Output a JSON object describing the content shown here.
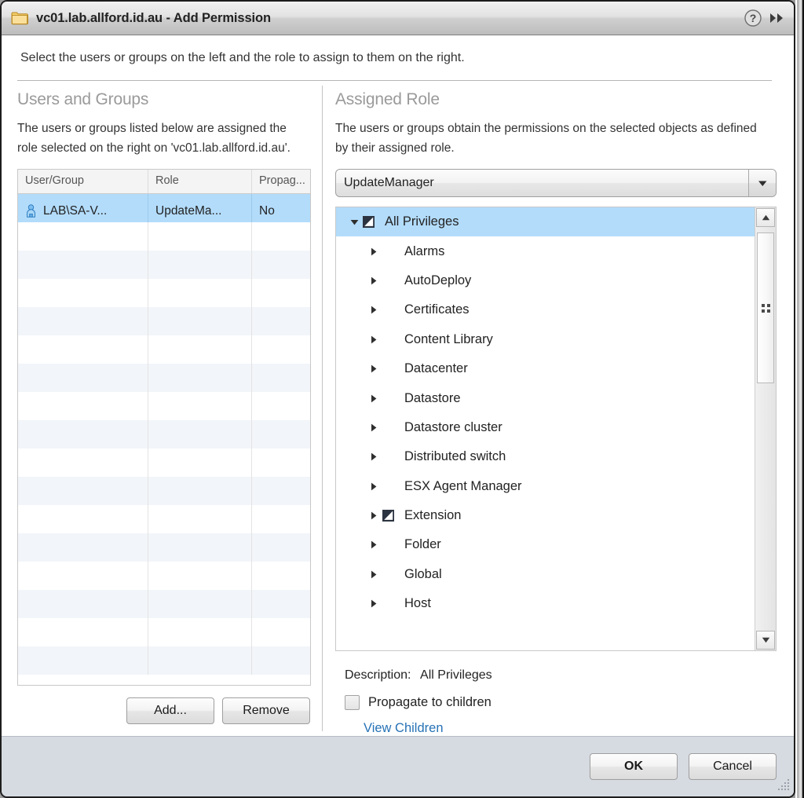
{
  "window": {
    "title": "vc01.lab.allford.id.au - Add Permission",
    "folder_icon": "folder-icon",
    "help_icon": "help-icon",
    "expand_icon": "double-chevron-right-icon"
  },
  "intro": {
    "text": "Select the users or groups on the left and the role to assign to them on the right."
  },
  "left_pane": {
    "heading": "Users and Groups",
    "description": "The users or groups listed below are assigned the role selected on the right on 'vc01.lab.allford.id.au'.",
    "table": {
      "columns": [
        "User/Group",
        "Role",
        "Propag..."
      ],
      "rows": [
        {
          "user": "LAB\\SA-V...",
          "role": "UpdateMa...",
          "propagate": "No",
          "selected": true,
          "icon": "user-icon"
        }
      ],
      "empty_row_count": 16
    },
    "buttons": {
      "add": "Add...",
      "remove": "Remove"
    }
  },
  "right_pane": {
    "heading": "Assigned Role",
    "description": "The users or groups obtain the permissions on the selected objects as defined by their assigned role.",
    "role_select": {
      "value": "UpdateManager",
      "arrow_icon": "chevron-down-icon"
    },
    "tree": [
      {
        "label": "All Privileges",
        "depth": 0,
        "expanded": true,
        "checkbox": "partial",
        "selected": true
      },
      {
        "label": "Alarms",
        "depth": 1,
        "expanded": false,
        "checkbox": "none",
        "selected": false
      },
      {
        "label": "AutoDeploy",
        "depth": 1,
        "expanded": false,
        "checkbox": "none",
        "selected": false
      },
      {
        "label": "Certificates",
        "depth": 1,
        "expanded": false,
        "checkbox": "none",
        "selected": false
      },
      {
        "label": "Content Library",
        "depth": 1,
        "expanded": false,
        "checkbox": "none",
        "selected": false
      },
      {
        "label": "Datacenter",
        "depth": 1,
        "expanded": false,
        "checkbox": "none",
        "selected": false
      },
      {
        "label": "Datastore",
        "depth": 1,
        "expanded": false,
        "checkbox": "none",
        "selected": false
      },
      {
        "label": "Datastore cluster",
        "depth": 1,
        "expanded": false,
        "checkbox": "none",
        "selected": false
      },
      {
        "label": "Distributed switch",
        "depth": 1,
        "expanded": false,
        "checkbox": "none",
        "selected": false
      },
      {
        "label": "ESX Agent Manager",
        "depth": 1,
        "expanded": false,
        "checkbox": "none",
        "selected": false
      },
      {
        "label": "Extension",
        "depth": 1,
        "expanded": false,
        "checkbox": "partial",
        "selected": false
      },
      {
        "label": "Folder",
        "depth": 1,
        "expanded": false,
        "checkbox": "none",
        "selected": false
      },
      {
        "label": "Global",
        "depth": 1,
        "expanded": false,
        "checkbox": "none",
        "selected": false
      },
      {
        "label": "Host",
        "depth": 1,
        "expanded": false,
        "checkbox": "none",
        "selected": false
      }
    ],
    "scrollbar": {
      "up_icon": "scroll-up-icon",
      "down_icon": "scroll-down-icon",
      "grip_icon": "grip-dots-icon"
    },
    "description_label": "Description:",
    "description_value": "All Privileges",
    "propagate": {
      "label": "Propagate to children",
      "checked": false
    },
    "view_children_link": "View Children"
  },
  "footer": {
    "ok": "OK",
    "cancel": "Cancel",
    "resize_icon": "resize-grip-icon"
  },
  "colors": {
    "selection": "#b3dcfb",
    "link": "#2672b5",
    "footer_bg": "#d6dae1",
    "heading": "#9a9a9a"
  }
}
